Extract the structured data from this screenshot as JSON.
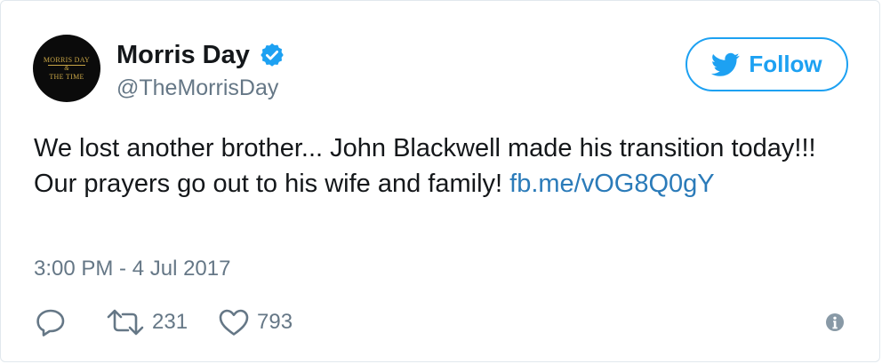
{
  "user": {
    "display_name": "Morris Day",
    "handle": "@TheMorrisDay",
    "avatar_logo": {
      "line1": "MORRIS DAY",
      "amp": "&",
      "line2": "THE TIME"
    },
    "verified": true
  },
  "follow_button": {
    "label": "Follow"
  },
  "tweet": {
    "line1": "We lost another brother... John Blackwell made his transition today!!!",
    "line2_text": "Our prayers go out to his wife and family! ",
    "link_text": "fb.me/vOG8Q0gY",
    "timestamp": "3:00 PM - 4 Jul 2017"
  },
  "actions": {
    "retweet_count": "231",
    "like_count": "793"
  },
  "icons": {
    "verified": "verified-badge-icon",
    "follow": "twitter-bird-icon",
    "reply": "reply-icon",
    "retweet": "retweet-icon",
    "like": "heart-icon",
    "info": "info-icon"
  },
  "colors": {
    "brand_blue": "#1da1f2",
    "link": "#2b7bb9",
    "muted": "#657786",
    "text": "#14171a",
    "border": "#e1e8ed"
  }
}
